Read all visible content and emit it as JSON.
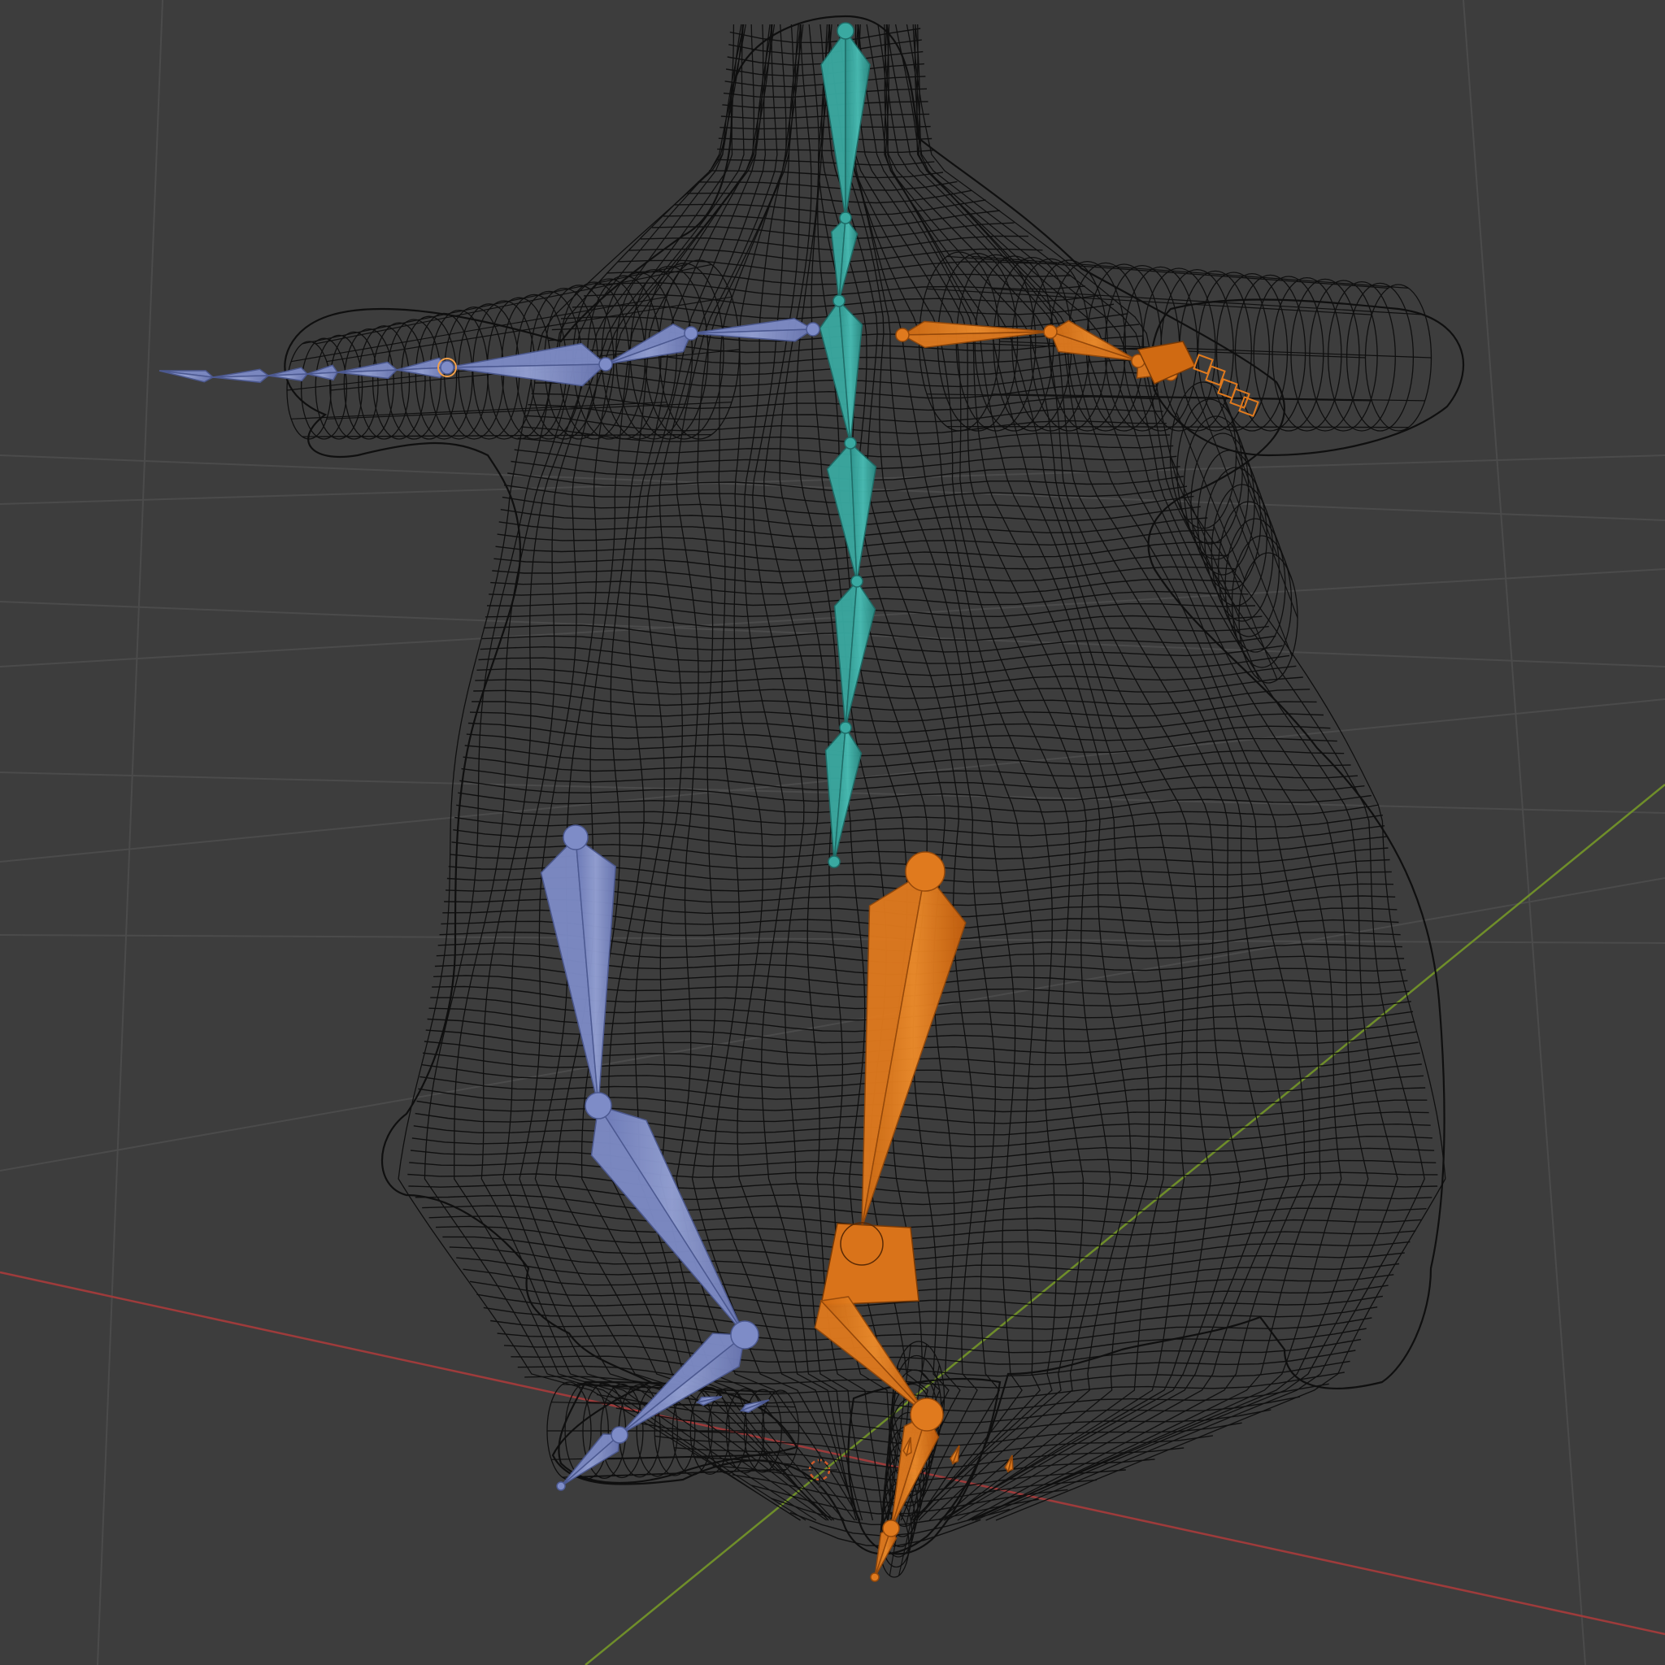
{
  "viewport": {
    "background": "#3d3d3d",
    "grid_color": "#4a4a4a",
    "axis_x_color": "#9e3b3b",
    "axis_y_color": "#6f8e2a",
    "wire_color": "#0c0c0c"
  },
  "object": {
    "mesh_display": "wireframe",
    "armature_display": "octahedral"
  },
  "bone_groups": {
    "spine": {
      "fill": "#3aa9a1",
      "edge": "#1f6e69"
    },
    "left": {
      "fill": "#7e8cc7",
      "edge": "#4d5a92"
    },
    "right": {
      "fill": "#e07a1e",
      "edge": "#96490a"
    }
  },
  "icons": {
    "origin": "3d-cursor-icon"
  }
}
